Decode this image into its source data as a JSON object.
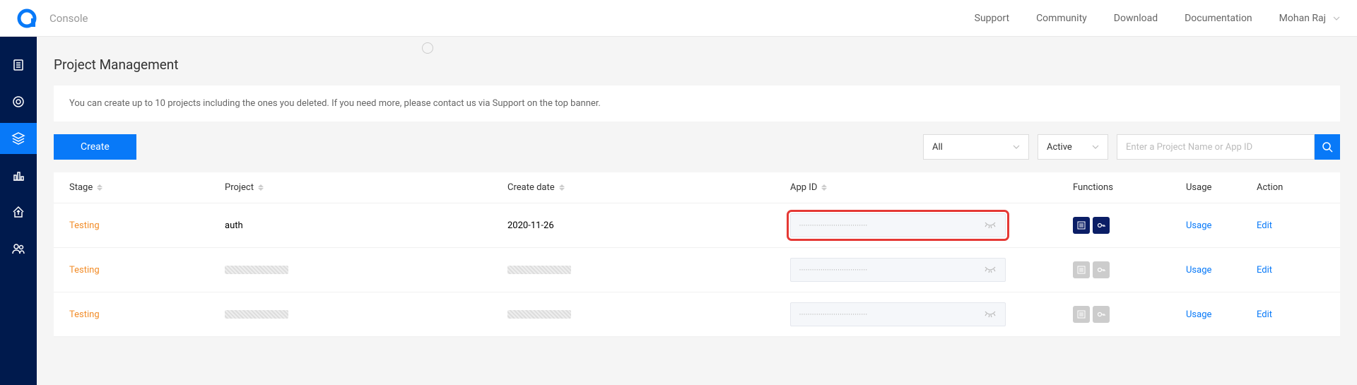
{
  "header": {
    "console_label": "Console",
    "nav": [
      "Support",
      "Community",
      "Download",
      "Documentation"
    ],
    "user_name": "Mohan Raj"
  },
  "page": {
    "title": "Project Management",
    "info_banner": "You can create up to 10 projects including the ones you deleted. If you need more, please contact us via Support on the top banner."
  },
  "toolbar": {
    "create_label": "Create",
    "filter_all": "All",
    "filter_status": "Active",
    "search_placeholder": "Enter a Project Name or App ID"
  },
  "table": {
    "headers": {
      "stage": "Stage",
      "project": "Project",
      "create_date": "Create date",
      "app_id": "App ID",
      "functions": "Functions",
      "usage": "Usage",
      "action": "Action"
    },
    "rows": [
      {
        "stage": "Testing",
        "project": "auth",
        "create_date": "2020-11-26",
        "app_id_masked": "••••••••••••••••••••••••••••••••",
        "highlighted": true,
        "func_active": true,
        "usage_label": "Usage",
        "edit_label": "Edit",
        "redacted": false
      },
      {
        "stage": "Testing",
        "project": "",
        "create_date": "",
        "app_id_masked": "••••••••••••••••••••••••••••••••",
        "highlighted": false,
        "func_active": false,
        "usage_label": "Usage",
        "edit_label": "Edit",
        "redacted": true
      },
      {
        "stage": "Testing",
        "project": "",
        "create_date": "",
        "app_id_masked": "••••••••••••••••••••••••••••••••",
        "highlighted": false,
        "func_active": false,
        "usage_label": "Usage",
        "edit_label": "Edit",
        "redacted": true
      }
    ]
  }
}
